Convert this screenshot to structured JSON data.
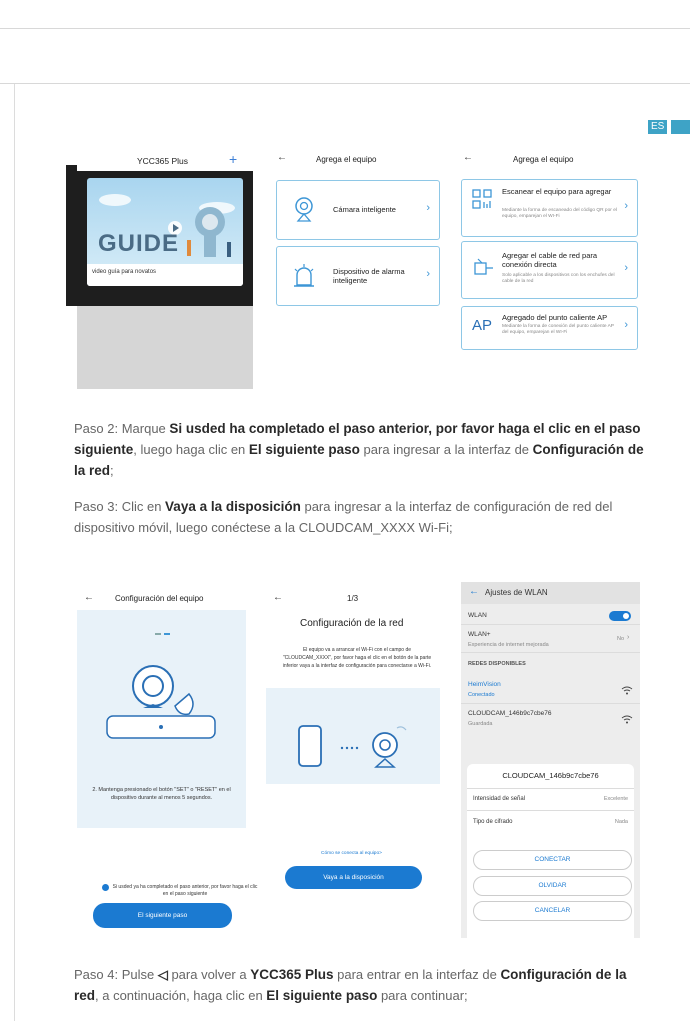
{
  "lang_tag": "ES",
  "screen1": {
    "app_title": "YCC365 Plus",
    "plus_icon": "plus-icon",
    "guide_word": "GUIDE",
    "caption": "video guía para novatos"
  },
  "screen2": {
    "title": "Agrega el equipo",
    "items": [
      {
        "label": "Cámara inteligente"
      },
      {
        "label": "Dispositivo de alarma inteligente"
      }
    ]
  },
  "screen3": {
    "title": "Agrega el equipo",
    "items": [
      {
        "label": "Escanear el equipo para agregar",
        "desc": "Mediante la forma de escaneado del código QR por el equipo, emparejan el WI-Fi",
        "icon": "qr-icon"
      },
      {
        "label": "Agregar el cable de red para conexión directa",
        "desc": "Solo aplicable a los dispositivos con los enchufes del cable de la red",
        "icon": "ethernet-icon"
      },
      {
        "label": "Agregado del punto caliente AP",
        "desc": "Mediante la forma de conexión del punto caliente AP del equipo, emparejan el WI-Fi",
        "icon": "AP"
      }
    ]
  },
  "paso2": {
    "p1": "Paso 2: Marque ",
    "b1": "Si usded ha completado el paso anterior, por favor haga el clic en el paso siguiente",
    "p2": ", luego haga clic en ",
    "b2": "El siguiente paso",
    "p3": " para ingresar a la interfaz de ",
    "b3": "Configuración de la red",
    "p4": ";"
  },
  "paso3": {
    "p1": "Paso 3: Clic en ",
    "b1": "Vaya a la disposición",
    "p2": " para ingresar a la interfaz de configuración de red del dispositivo móvil, luego conéctese a la CLOUDCAM_XXXX Wi-Fi;"
  },
  "screen4": {
    "title": "Configuración del equipo",
    "instruction": "2. Mantenga presionado el botón \"SET\" o \"RESET\" en el dispositivo durante al menos 5 segundos.",
    "checkbox_text": "Si usded ya ha completado el paso anterior, por favor haga el clic en el paso siguiente",
    "button": "El siguiente paso"
  },
  "screen5": {
    "step": "1/3",
    "title": "Configuración de la red",
    "desc": "El equipo va a arrancar el Wi-Fi con el campo de \"CLOUDCAM_XXXX\", por favor haga el clic en el botón de la parte inferior vaya a la interfaz de configuración para conectarse a Wi-Fi.",
    "link": "Cómo se conecta al equipo>",
    "button": "Vaya a la disposición"
  },
  "screen6": {
    "title": "Ajustes de WLAN",
    "wlan": "WLAN",
    "wlan_plus": "WLAN+",
    "wlan_plus_sub": "Experiencia de internet mejorada",
    "wlan_plus_value": "No",
    "section": "REDES DISPONIBLES",
    "net1": "HeimVision",
    "net1_sub": "Conectado",
    "net2": "CLOUDCAM_146b9c7cbe76",
    "net2_sub": "Guardada",
    "sheet_title": "CLOUDCAM_146b9c7cbe76",
    "signal_label": "Intensidad de señal",
    "signal_value": "Excelente",
    "cipher_label": "Tipo de cifrado",
    "cipher_value": "Nada",
    "btn_connect": "CONECTAR",
    "btn_forget": "OLVIDAR",
    "btn_cancel": "CANCELAR"
  },
  "paso4": {
    "p1": "Paso 4: Pulse ",
    "p2": " para volver a ",
    "b1": "YCC365 Plus",
    "p3": " para entrar en la interfaz de ",
    "b2": "Configuración de la red",
    "p4": ", a continuación, haga clic en ",
    "b3": "El siguiente paso",
    "p5": " para continuar;"
  }
}
